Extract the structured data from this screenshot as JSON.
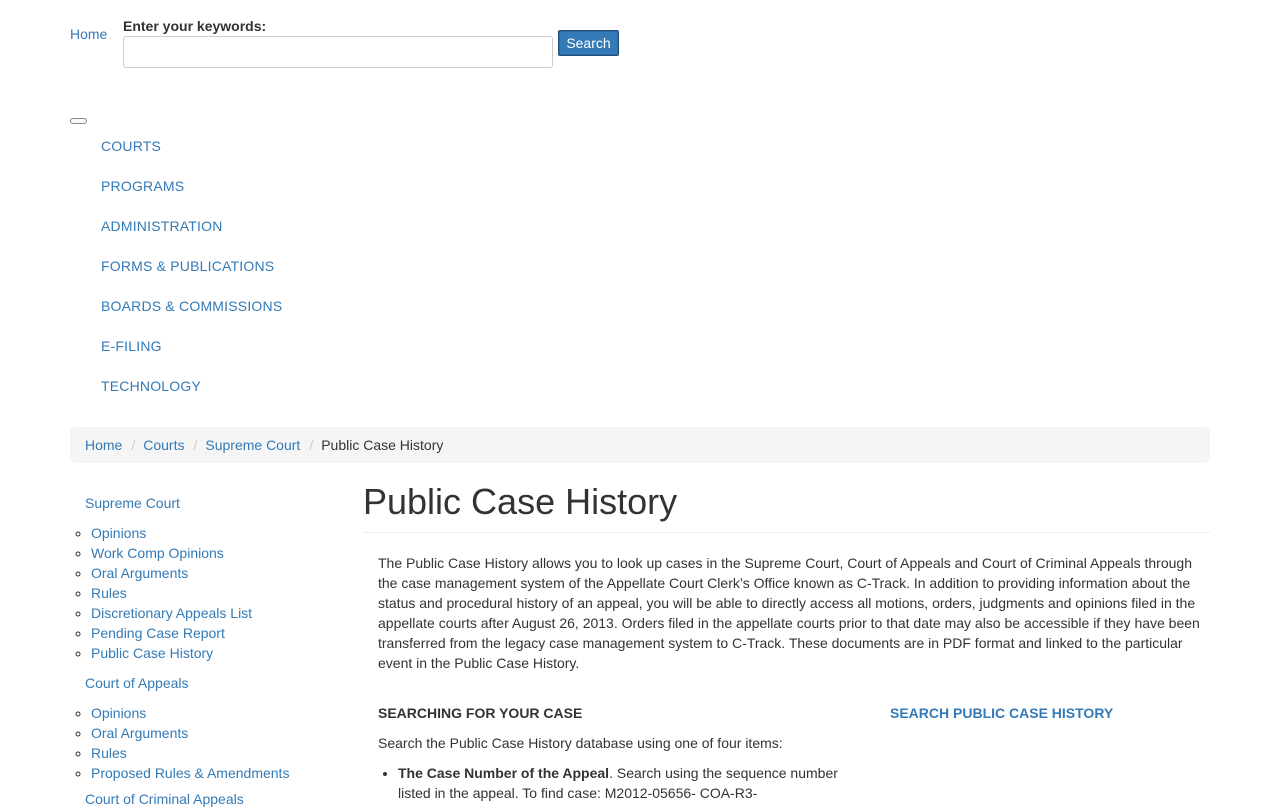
{
  "header": {
    "home_alt": "Home",
    "keywords_label": "Enter your keywords:",
    "search_value": "",
    "search_button": "Search"
  },
  "nav": {
    "items": [
      {
        "label": "COURTS"
      },
      {
        "label": "PROGRAMS"
      },
      {
        "label": "ADMINISTRATION"
      },
      {
        "label": "FORMS & PUBLICATIONS"
      },
      {
        "label": "BOARDS & COMMISSIONS"
      },
      {
        "label": "E-FILING"
      },
      {
        "label": "TECHNOLOGY"
      }
    ]
  },
  "breadcrumb": {
    "items": [
      "Home",
      "Courts",
      "Supreme Court"
    ],
    "separator": "/",
    "current": "Public Case History"
  },
  "sidebar": {
    "groups": [
      {
        "heading": "Supreme Court",
        "links": [
          "Opinions",
          "Work Comp Opinions",
          "Oral Arguments",
          "Rules",
          "Discretionary Appeals List",
          "Pending Case Report",
          "Public Case History"
        ]
      },
      {
        "heading": "Court of Appeals",
        "links": [
          "Opinions",
          "Oral Arguments",
          "Rules",
          "Proposed Rules & Amendments"
        ]
      },
      {
        "heading": "Court of Criminal Appeals",
        "links": []
      }
    ]
  },
  "content": {
    "title": "Public Case History",
    "intro": "The Public Case History allows you to look up cases in the Supreme Court, Court of Appeals and Court of Criminal Appeals through the case management system of the Appellate Court Clerk’s Office known as C-Track.  In addition to providing information about the status and procedural history of an appeal, you will be able to directly access all motions, orders, judgments and opinions filed in the appellate courts after August 26, 2013.  Orders filed in the appellate courts prior to that date may also be accessible if they have been transferred from the legacy case management system to C-Track. These documents are in PDF format and linked to the particular event in the Public Case History.",
    "section_heading": "SEARCHING FOR YOUR CASE",
    "section_link": "SEARCH PUBLIC CASE HISTORY",
    "section_text": "Search the Public Case History database using one of four items:",
    "bullet1_bold": "The Case Number of the Appeal",
    "bullet1_text": ". Search using the sequence number listed in the appeal.  To find case: M2012-05656-     COA-R3-"
  }
}
